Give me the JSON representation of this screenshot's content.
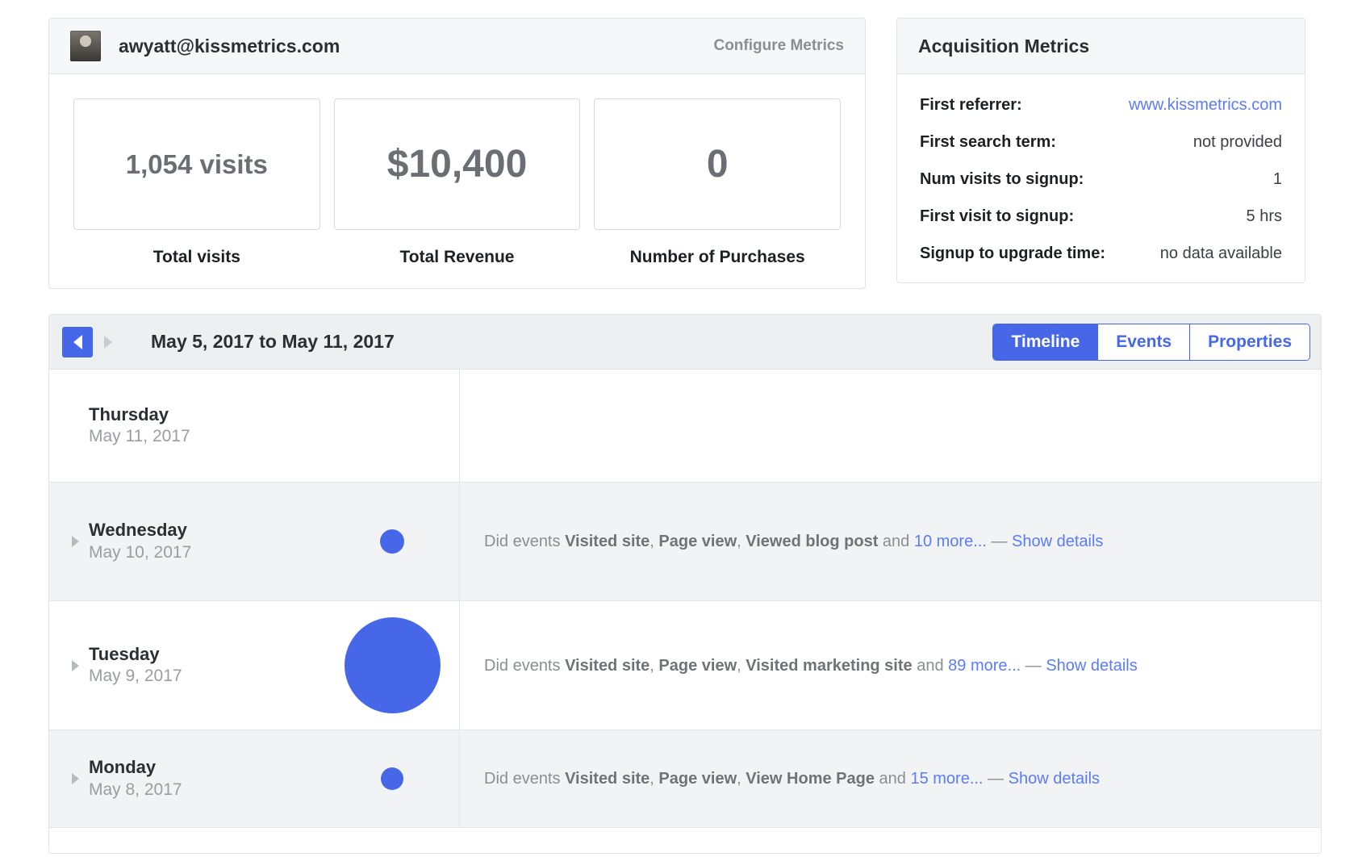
{
  "user_panel": {
    "avatar_alt": "user-avatar",
    "email": "awyatt@kissmetrics.com",
    "configure_label": "Configure Metrics",
    "metrics": [
      {
        "value": "1,054 visits",
        "label": "Total visits",
        "size": "sm"
      },
      {
        "value": "$10,400",
        "label": "Total Revenue",
        "size": "lg"
      },
      {
        "value": "0",
        "label": "Number of Purchases",
        "size": "lg"
      }
    ]
  },
  "acquisition": {
    "title": "Acquisition Metrics",
    "rows": [
      {
        "key": "First referrer:",
        "value": "www.kissmetrics.com",
        "is_link": true
      },
      {
        "key": "First search term:",
        "value": "not provided",
        "is_link": false
      },
      {
        "key": "Num visits to signup:",
        "value": "1",
        "is_link": false
      },
      {
        "key": "First visit to signup:",
        "value": "5 hrs",
        "is_link": false
      },
      {
        "key": "Signup to upgrade time:",
        "value": "no data available",
        "is_link": false
      }
    ]
  },
  "timeline": {
    "date_range": "May 5, 2017 to May 11, 2017",
    "prev_icon": "caret-left-icon",
    "next_icon": "caret-right-icon",
    "tabs": [
      {
        "label": "Timeline",
        "active": true
      },
      {
        "label": "Events",
        "active": false
      },
      {
        "label": "Properties",
        "active": false
      }
    ],
    "rows": [
      {
        "day": "Thursday",
        "date": "May 11, 2017",
        "bubble_size": 0,
        "has_caret": false,
        "prefix": "",
        "events": [],
        "and_text": "",
        "more_link": "",
        "dash": "",
        "details_link": ""
      },
      {
        "day": "Wednesday",
        "date": "May 10, 2017",
        "bubble_size": 30,
        "has_caret": true,
        "prefix": "Did events ",
        "events": [
          "Visited site",
          "Page view",
          "Viewed blog post"
        ],
        "and_text": " and ",
        "more_link": "10 more...",
        "dash": " — ",
        "details_link": "Show details"
      },
      {
        "day": "Tuesday",
        "date": "May 9, 2017",
        "bubble_size": 119,
        "has_caret": true,
        "prefix": "Did events ",
        "events": [
          "Visited site",
          "Page view",
          "Visited marketing site"
        ],
        "and_text": " and ",
        "more_link": "89 more...",
        "dash": " — ",
        "details_link": "Show details"
      },
      {
        "day": "Monday",
        "date": "May 8, 2017",
        "bubble_size": 28,
        "has_caret": true,
        "prefix": "Did events ",
        "events": [
          "Visited site",
          "Page view",
          "View Home Page"
        ],
        "and_text": " and ",
        "more_link": "15 more...",
        "dash": " — ",
        "details_link": "Show details"
      }
    ]
  },
  "colors": {
    "accent": "#4668e8",
    "link": "#5b7cfa",
    "panel_border": "#e2e3e5",
    "muted_text": "#8a8e94"
  }
}
